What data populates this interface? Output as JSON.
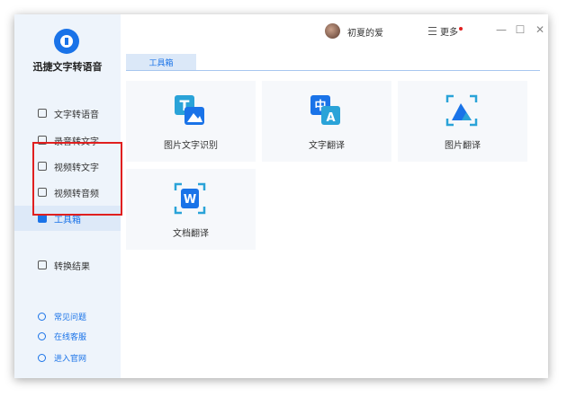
{
  "app": {
    "title": "迅捷文字转语音"
  },
  "sidebar": {
    "items": [
      {
        "label": "文字转语音"
      },
      {
        "label": "录音转文字"
      },
      {
        "label": "视频转文字"
      },
      {
        "label": "视频转音频"
      },
      {
        "label": "工具箱",
        "active": true
      },
      {
        "label": "转换结果"
      }
    ],
    "help": [
      {
        "label": "常见问题"
      },
      {
        "label": "在线客服"
      },
      {
        "label": "进入官网"
      }
    ]
  },
  "header": {
    "username": "初夏的爱",
    "more_label": "更多",
    "window_controls": {
      "minimize": "—",
      "maximize": "☐",
      "close": "✕"
    }
  },
  "tabs": [
    {
      "label": "工具箱"
    }
  ],
  "tools": [
    {
      "label": "图片文字识别",
      "icon": "image-text-recognition-icon"
    },
    {
      "label": "文字翻译",
      "icon": "text-translate-icon"
    },
    {
      "label": "图片翻译",
      "icon": "image-translate-icon"
    },
    {
      "label": "文档翻译",
      "icon": "document-translate-icon"
    }
  ],
  "colors": {
    "accent": "#1a73e8",
    "highlight_box": "#e01f1f",
    "sidebar_bg": "#eef4fb"
  }
}
